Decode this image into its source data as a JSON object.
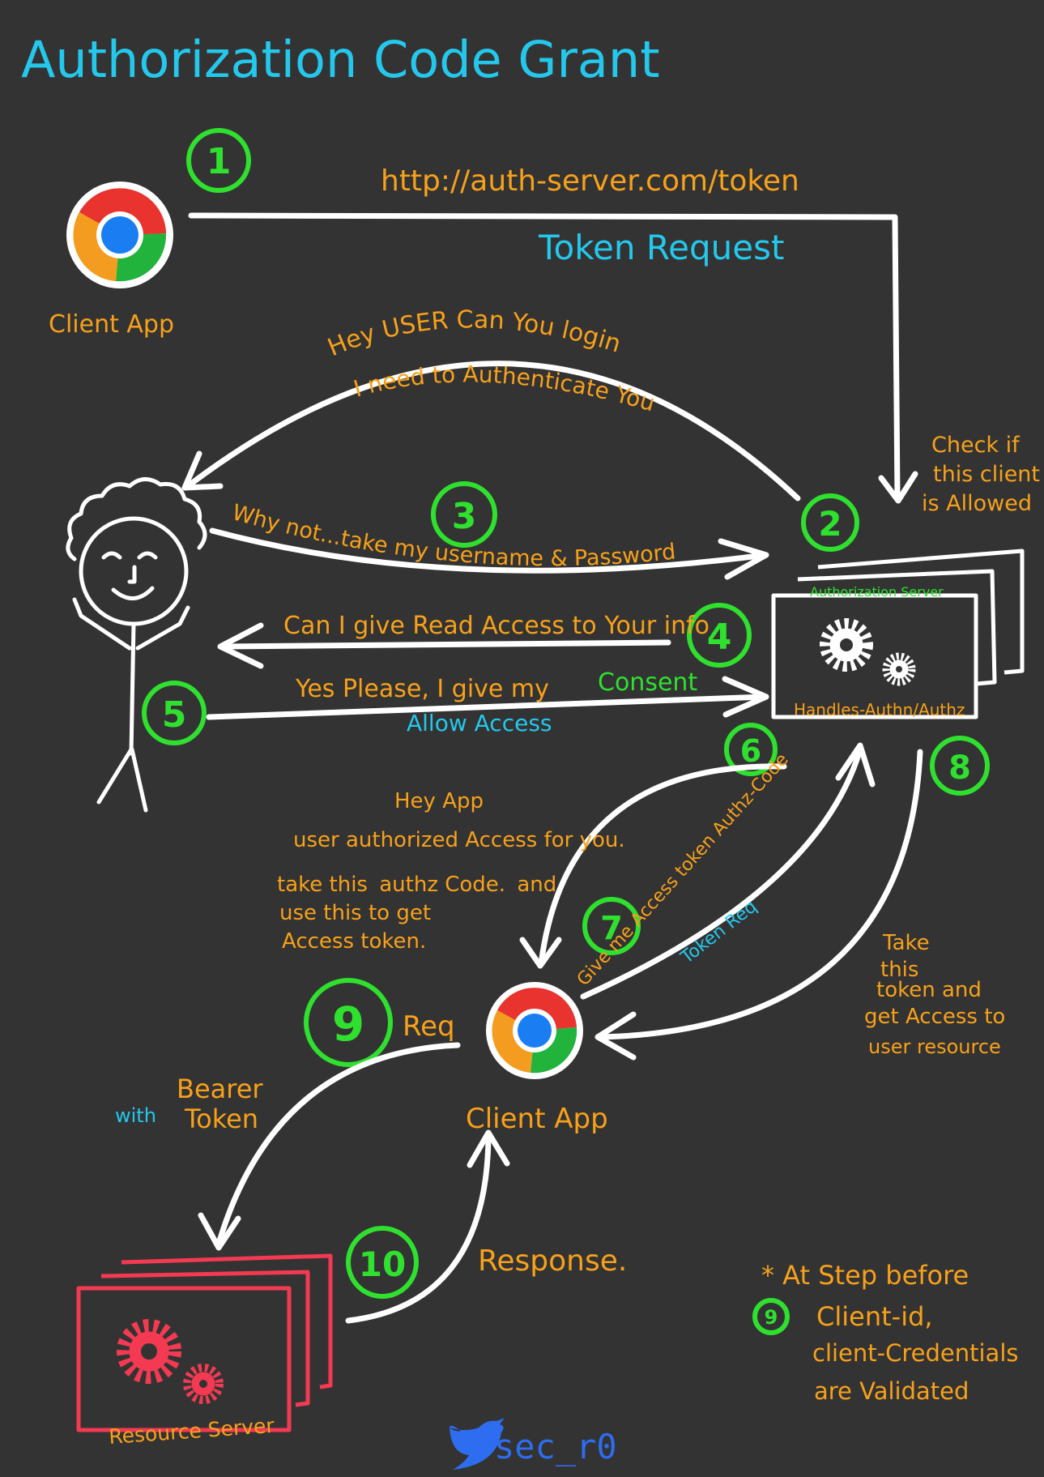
{
  "title": "Authorization Code Grant",
  "token_url": "http://auth-server.com/token",
  "token_request": "Token Request",
  "client_app_top": "Client App",
  "client_app_bottom": "Client App",
  "hey_user_line1": "Hey USER Can You login",
  "hey_user_line2": "I need to Authenticate You",
  "check_client": [
    "Check if",
    "this client",
    "is Allowed"
  ],
  "why_not": "Why not...take my username & Password",
  "read_access": "Can I give Read Access to Your info",
  "yes_please": "Yes Please, I give my",
  "consent": "Consent",
  "allow_access": "Allow Access",
  "auth_server_label": "Authorization Server",
  "handles": "Handles-Authn/Authz",
  "hey_app": [
    "Hey App",
    "user authorized Access for you."
  ],
  "take_code": {
    "pre": "take this",
    "code": "authz Code.",
    "post": "and",
    "line2": "use this to get",
    "line3": "Access token."
  },
  "give_me": "Give me Access token Authz-Code",
  "token_req": "Token Req",
  "take_token": [
    "Take",
    "this",
    "token and",
    "get Access to",
    "user resource"
  ],
  "req": "Req",
  "with": "with",
  "bearer_token": [
    "Bearer",
    "Token"
  ],
  "response": "Response.",
  "resource_server": "Resource Server",
  "note": {
    "line1": "* At Step before",
    "step": "9",
    "line2": "Client-id,",
    "line3": "client-Credentials",
    "line4": "are Validated"
  },
  "handle": "sec_r0",
  "steps": [
    "1",
    "2",
    "3",
    "4",
    "5",
    "6",
    "7",
    "8",
    "9",
    "10"
  ],
  "colors": {
    "background": "#333333",
    "orange": "#f7a11b",
    "blue": "#24c8ec",
    "green": "#2fe02f",
    "red": "#f33a52",
    "white": "#ffffff"
  }
}
